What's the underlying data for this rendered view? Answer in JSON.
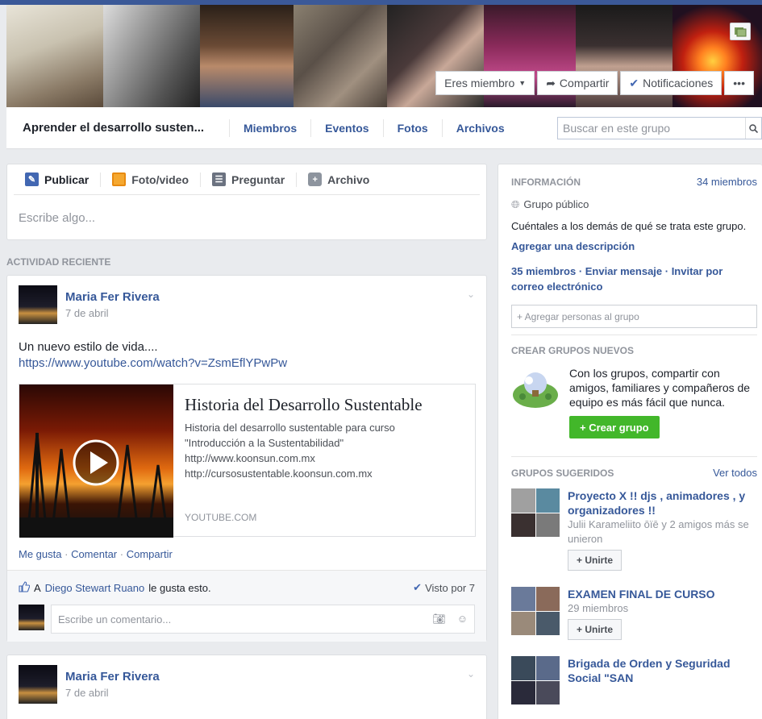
{
  "cover": {
    "member_btn": "Eres miembro",
    "share_btn": "Compartir",
    "notif_btn": "Notificaciones",
    "more_btn": "•••"
  },
  "nav": {
    "group_name": "Aprender el desarrollo susten...",
    "links": [
      "Miembros",
      "Eventos",
      "Fotos",
      "Archivos"
    ],
    "search_placeholder": "Buscar en este grupo"
  },
  "composer": {
    "tabs": [
      "Publicar",
      "Foto/video",
      "Preguntar",
      "Archivo"
    ],
    "placeholder": "Escribe algo..."
  },
  "activity_title": "ACTIVIDAD RECIENTE",
  "post": {
    "author": "Maria Fer Rivera",
    "date": "7 de abril",
    "text": "Un nuevo estilo de vida....",
    "link": "https://www.youtube.com/watch?v=ZsmEflYPwPw",
    "share_title": "Historia del Desarrollo Sustentable",
    "share_desc": [
      "Historia del desarrollo sustentable para curso",
      "\"Introducción a la Sustentabilidad\"",
      "http://www.koonsun.com.mx",
      "http://cursosustentable.koonsun.com.mx"
    ],
    "share_domain": "YOUTUBE.COM",
    "actions": [
      "Me gusta",
      "Comentar",
      "Compartir"
    ],
    "like_prefix": "A",
    "like_user": "Diego Stewart Ruano",
    "like_suffix": "le gusta esto.",
    "seen": "Visto por 7",
    "comment_placeholder": "Escribe un comentario..."
  },
  "post2": {
    "author": "Maria Fer Rivera",
    "date": "7 de abril"
  },
  "info": {
    "title": "INFORMACIÓN",
    "count": "34 miembros",
    "privacy": "Grupo público",
    "prompt": "Cuéntales a los demás de qué se trata este grupo.",
    "add_desc": "Agregar una descripción",
    "members_line": "35 miembros · Enviar mensaje · Invitar por correo electrónico",
    "add_people": "+ Agregar personas al grupo"
  },
  "create": {
    "title": "CREAR GRUPOS NUEVOS",
    "text": "Con los grupos, compartir con amigos, familiares y compañeros de equipo es más fácil que nunca.",
    "button": "+ Crear grupo"
  },
  "suggested": {
    "title": "GRUPOS SUGERIDOS",
    "see_all": "Ver todos",
    "join_label": "+ Unirte",
    "groups": [
      {
        "name": "Proyecto X !! djs , animadores , y organizadores !!",
        "meta": "Julii Karameliito ōïē y 2 amigos más se unieron"
      },
      {
        "name": "EXAMEN FINAL DE CURSO",
        "meta": "29 miembros"
      },
      {
        "name": "Brigada de Orden y Seguridad Social \"SAN",
        "meta": ""
      }
    ]
  },
  "colors": {
    "brand": "#3b5998",
    "link": "#365899",
    "green": "#42b72a"
  }
}
